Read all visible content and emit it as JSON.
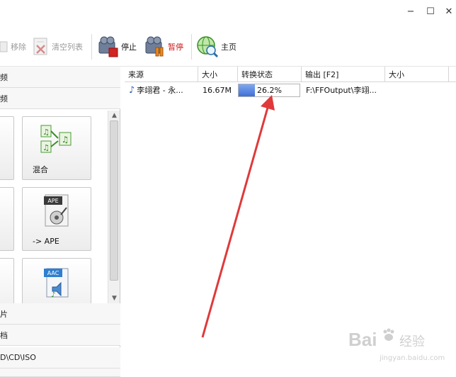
{
  "window": {
    "minimize_label": "−",
    "maximize_label": "☐",
    "close_label": "✕"
  },
  "toolbar": {
    "remove_label": "移除",
    "clear_list_label": "清空列表",
    "stop_label": "停止",
    "pause_label": "暂停",
    "home_label": "主页",
    "pause_color": "#cc1a1a"
  },
  "sidebar": {
    "rows_top": [
      "频",
      "频"
    ],
    "tiles": [
      {
        "label": "混合",
        "icon": "audio-merge-icon"
      },
      {
        "label": "-> APE",
        "icon": "ape-format-icon",
        "badge": "APE"
      },
      {
        "label": "",
        "icon": "aac-format-icon",
        "badge": "AAC"
      }
    ],
    "rows_bottom": [
      "片",
      "档",
      "D\\CD\\ISO"
    ]
  },
  "table": {
    "columns": [
      "来源",
      "大小",
      "转换状态",
      "输出 [F2]",
      "大小"
    ],
    "rows": [
      {
        "source": "李翊君 - 永...",
        "size": "16.67M",
        "progress": 0.262,
        "progress_text": "26.2%",
        "output": "F:\\FFOutput\\李翊...",
        "out_size": ""
      }
    ]
  },
  "watermark": {
    "brand": "Bai",
    "brand2": "经验",
    "url": "jingyan.baidu.com",
    "color": "#c9c9c9"
  },
  "annotation": {
    "arrow_color": "#e0393a"
  }
}
